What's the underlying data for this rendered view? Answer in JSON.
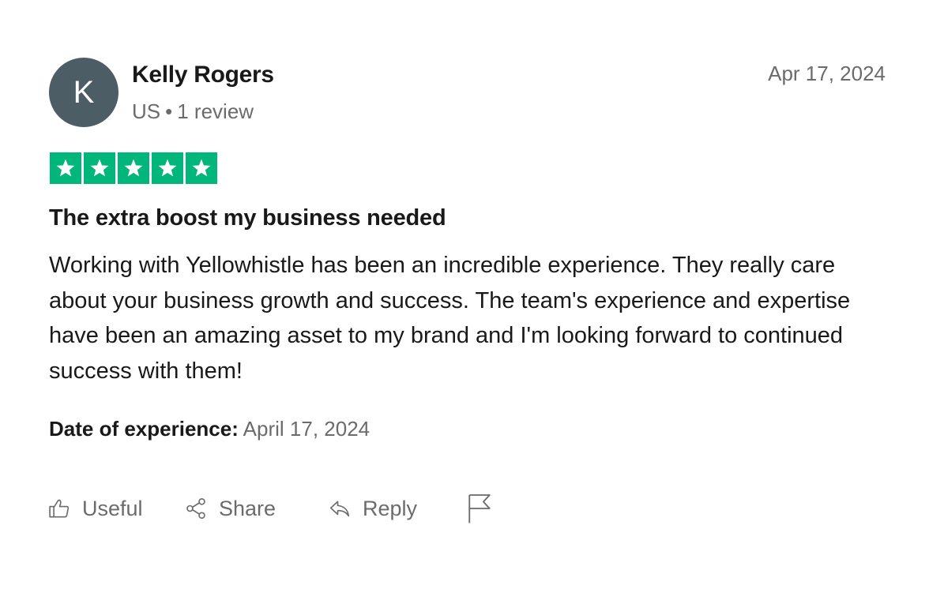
{
  "reviewer": {
    "initial": "K",
    "name": "Kelly Rogers",
    "country": "US",
    "separator": "•",
    "review_count": "1 review",
    "avatar_color": "#4d5d66"
  },
  "review": {
    "date": "Apr 17, 2024",
    "rating": 5,
    "rating_max": 5,
    "star_color": "#00b67a",
    "title": "The extra boost my business needed",
    "body": "Working with Yellowhistle has been an incredible experience. They really care about your business growth and success. The team's experience and expertise have been an amazing asset to my brand and I'm looking forward to continued success with them!",
    "experience_label": "Date of experience:",
    "experience_date": "April 17, 2024"
  },
  "actions": {
    "useful_label": "Useful",
    "share_label": "Share",
    "reply_label": "Reply",
    "icons": [
      "thumbs-up-icon",
      "share-icon",
      "reply-icon",
      "flag-icon"
    ]
  }
}
